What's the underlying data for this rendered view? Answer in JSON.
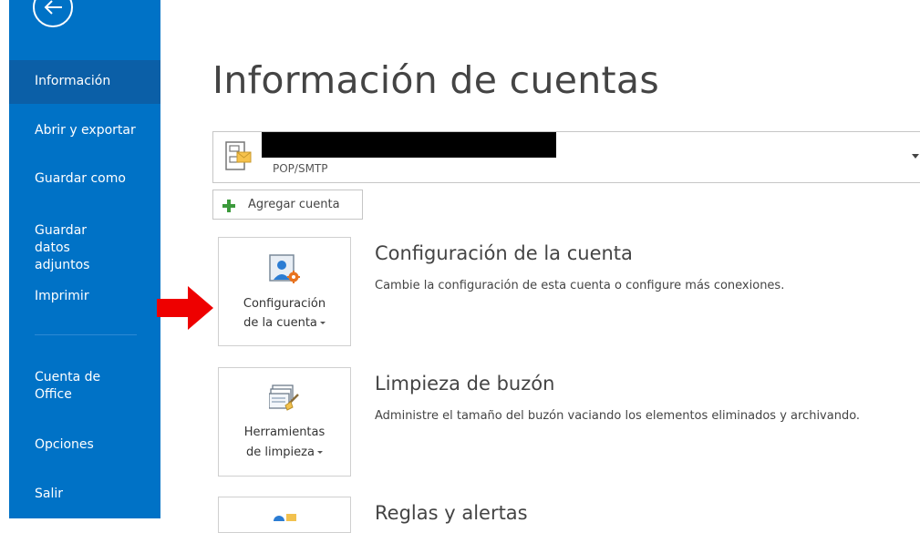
{
  "sidebar": {
    "items": [
      {
        "label": "Información",
        "active": true
      },
      {
        "label": "Abrir y exportar"
      },
      {
        "label": "Guardar como"
      },
      {
        "label": "Guardar datos adjuntos"
      },
      {
        "label": "Imprimir"
      },
      {
        "label": "Cuenta de Office"
      },
      {
        "label": "Opciones"
      },
      {
        "label": "Salir"
      }
    ],
    "accent_color": "#0072c6",
    "active_color": "#0b5fa7"
  },
  "main": {
    "title": "Información de cuentas",
    "account": {
      "type": "POP/SMTP"
    },
    "add_account_label": "Agregar cuenta",
    "sections": [
      {
        "tile_label_line1": "Configuración",
        "tile_label_line2": "de la cuenta",
        "heading": "Configuración de la cuenta",
        "description": "Cambie la configuración de esta cuenta o configure más conexiones."
      },
      {
        "tile_label_line1": "Herramientas",
        "tile_label_line2": "de limpieza",
        "heading": "Limpieza de buzón",
        "description": "Administre el tamaño del buzón vaciando los elementos eliminados y archivando."
      },
      {
        "heading": "Reglas y alertas"
      }
    ]
  },
  "icons": {
    "back": "back-arrow-icon",
    "account": "account-envelope-icon",
    "plus": "plus-icon",
    "settings": "account-settings-icon",
    "cleanup": "cleanup-tools-icon",
    "rules": "rules-alerts-icon",
    "annotation": "red-arrow-icon"
  }
}
